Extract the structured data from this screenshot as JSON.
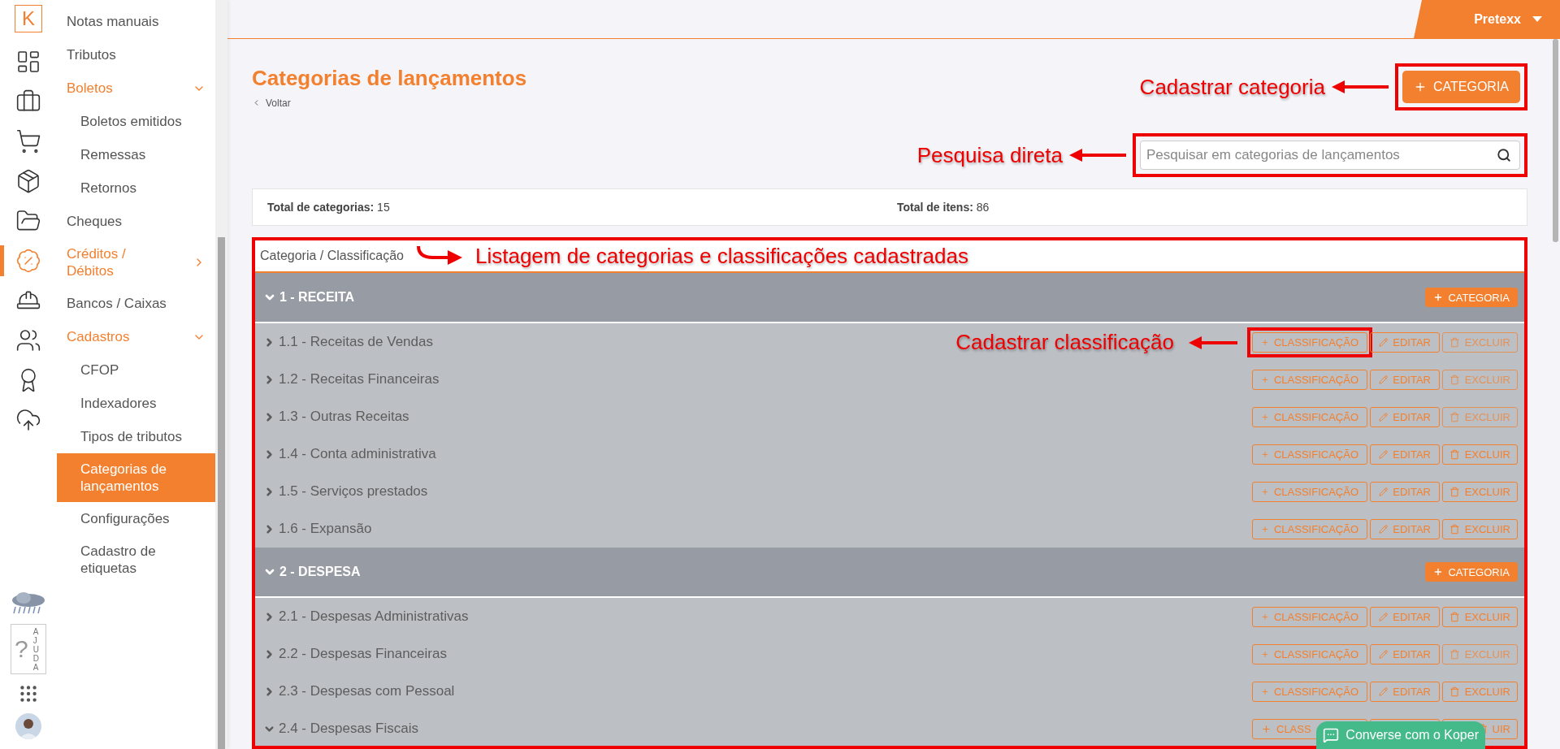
{
  "rail": {
    "logo": "K",
    "help_mark": "?",
    "help_label": "AJUDA",
    "items": [
      {
        "selected": false
      },
      {
        "selected": false
      },
      {
        "selected": false
      },
      {
        "selected": false
      },
      {
        "selected": false
      },
      {
        "selected": true
      },
      {
        "selected": false
      },
      {
        "selected": false
      },
      {
        "selected": false
      },
      {
        "selected": false
      }
    ]
  },
  "sidebar": {
    "items": [
      {
        "label": "Notas manuais",
        "kind": "link",
        "selected": false
      },
      {
        "label": "Tributos",
        "kind": "link",
        "selected": false
      },
      {
        "label": "Boletos",
        "kind": "group",
        "expanded": true,
        "children": [
          {
            "label": "Boletos emitidos",
            "selected": false
          },
          {
            "label": "Remessas",
            "selected": false
          },
          {
            "label": "Retornos",
            "selected": false
          }
        ]
      },
      {
        "label": "Cheques",
        "kind": "link",
        "selected": false
      },
      {
        "label": "Créditos / Débitos",
        "kind": "group",
        "expanded": false
      },
      {
        "label": "Bancos / Caixas",
        "kind": "link",
        "selected": false
      },
      {
        "label": "Cadastros",
        "kind": "group",
        "expanded": true,
        "children": [
          {
            "label": "CFOP",
            "selected": false
          },
          {
            "label": "Indexadores",
            "selected": false
          },
          {
            "label": "Tipos de tributos",
            "selected": false
          },
          {
            "label": "Categorias de lançamentos",
            "selected": true
          },
          {
            "label": "Configurações",
            "selected": false
          },
          {
            "label": "Cadastro de etiquetas",
            "selected": false
          }
        ]
      }
    ]
  },
  "topbar": {
    "user": "Pretexx"
  },
  "page": {
    "title": "Categorias de lançamentos",
    "back": "Voltar",
    "add_button": "CATEGORIA"
  },
  "search": {
    "placeholder": "Pesquisar em categorias de lançamentos"
  },
  "totals": [
    "**Total de categorias:** 15",
    "**Total de itens:** 86"
  ],
  "annotations": {
    "add_category": "Cadastrar categoria",
    "search": "Pesquisa direta",
    "list": "Listagem de categorias e classificações cadastradas",
    "add_classification": "Cadastrar classificação"
  },
  "list": {
    "header": "Categoria / Classificação",
    "categories": [
      {
        "label": "1 - RECEITA",
        "expanded": true,
        "add_label": "CATEGORIA",
        "children": [
          {
            "label": "1.1 - Receitas de Vendas",
            "expanded": false,
            "buttons": [
              {
                "kind": "add",
                "label": "CLASSIFICAÇÃO",
                "disabled": false
              },
              {
                "kind": "edit",
                "label": "EDITAR",
                "disabled": false
              },
              {
                "kind": "delete",
                "label": "EXCLUIR",
                "disabled": true
              }
            ]
          },
          {
            "label": "1.2 - Receitas Financeiras",
            "expanded": false,
            "buttons": [
              {
                "kind": "add",
                "label": "CLASSIFICAÇÃO",
                "disabled": false
              },
              {
                "kind": "edit",
                "label": "EDITAR",
                "disabled": false
              },
              {
                "kind": "delete",
                "label": "EXCLUIR",
                "disabled": true
              }
            ]
          },
          {
            "label": "1.3 - Outras Receitas",
            "expanded": false,
            "buttons": [
              {
                "kind": "add",
                "label": "CLASSIFICAÇÃO",
                "disabled": false
              },
              {
                "kind": "edit",
                "label": "EDITAR",
                "disabled": false
              },
              {
                "kind": "delete",
                "label": "EXCLUIR",
                "disabled": true
              }
            ]
          },
          {
            "label": "1.4 - Conta administrativa",
            "expanded": false,
            "buttons": [
              {
                "kind": "add",
                "label": "CLASSIFICAÇÃO",
                "disabled": false
              },
              {
                "kind": "edit",
                "label": "EDITAR",
                "disabled": false
              },
              {
                "kind": "delete",
                "label": "EXCLUIR",
                "disabled": false
              }
            ]
          },
          {
            "label": "1.5 - Serviços prestados",
            "expanded": false,
            "buttons": [
              {
                "kind": "add",
                "label": "CLASSIFICAÇÃO",
                "disabled": false
              },
              {
                "kind": "edit",
                "label": "EDITAR",
                "disabled": false
              },
              {
                "kind": "delete",
                "label": "EXCLUIR",
                "disabled": false
              }
            ]
          },
          {
            "label": "1.6 - Expansão",
            "expanded": false,
            "buttons": [
              {
                "kind": "add",
                "label": "CLASSIFICAÇÃO",
                "disabled": false
              },
              {
                "kind": "edit",
                "label": "EDITAR",
                "disabled": false
              },
              {
                "kind": "delete",
                "label": "EXCLUIR",
                "disabled": false
              }
            ]
          }
        ]
      },
      {
        "label": "2 - DESPESA",
        "expanded": true,
        "add_label": "CATEGORIA",
        "children": [
          {
            "label": "2.1 - Despesas Administrativas",
            "expanded": false,
            "buttons": [
              {
                "kind": "add",
                "label": "CLASSIFICAÇÃO",
                "disabled": false
              },
              {
                "kind": "edit",
                "label": "EDITAR",
                "disabled": false
              },
              {
                "kind": "delete",
                "label": "EXCLUIR",
                "disabled": false
              }
            ]
          },
          {
            "label": "2.2 - Despesas Financeiras",
            "expanded": false,
            "buttons": [
              {
                "kind": "add",
                "label": "CLASSIFICAÇÃO",
                "disabled": false
              },
              {
                "kind": "edit",
                "label": "EDITAR",
                "disabled": false
              },
              {
                "kind": "delete",
                "label": "EXCLUIR",
                "disabled": true
              }
            ]
          },
          {
            "label": "2.3 - Despesas com Pessoal",
            "expanded": false,
            "buttons": [
              {
                "kind": "add",
                "label": "CLASSIFICAÇÃO",
                "disabled": false
              },
              {
                "kind": "edit",
                "label": "EDITAR",
                "disabled": false
              },
              {
                "kind": "delete",
                "label": "EXCLUIR",
                "disabled": false
              }
            ]
          },
          {
            "label": "2.4 - Despesas Fiscais",
            "expanded": true,
            "buttons": [
              {
                "kind": "add",
                "label": "CLASS",
                "disabled": false
              },
              {
                "kind": "edit",
                "disabled": false
              },
              {
                "kind": "delete",
                "label": "UIR",
                "disabled": false
              }
            ]
          }
        ]
      }
    ]
  },
  "chat": {
    "label": "Converse com o Koper"
  }
}
